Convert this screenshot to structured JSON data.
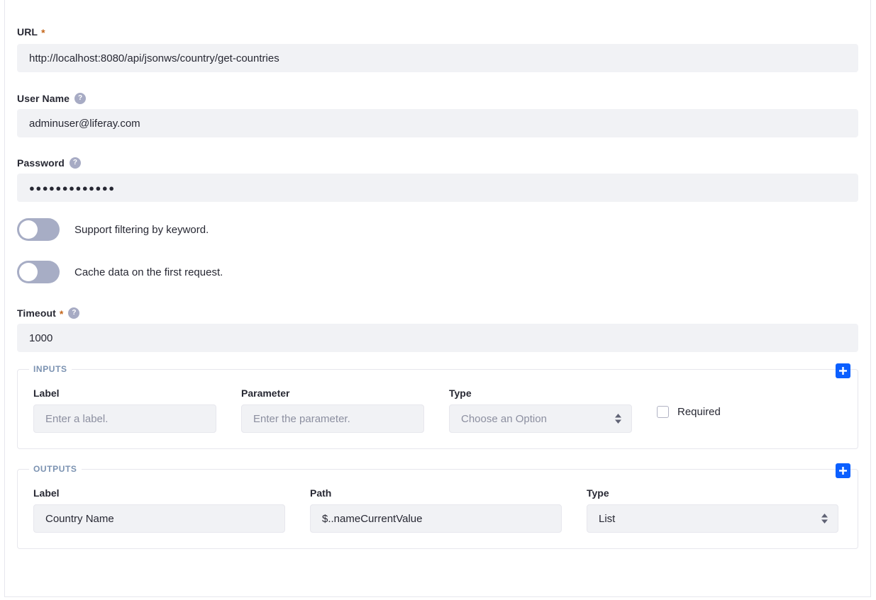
{
  "form": {
    "url": {
      "label": "URL",
      "required_marker": "*",
      "value": "http://localhost:8080/api/jsonws/country/get-countries"
    },
    "user_name": {
      "label": "User Name",
      "help_icon": "help-question-icon",
      "value": "adminuser@liferay.com"
    },
    "password": {
      "label": "Password",
      "help_icon": "help-question-icon",
      "value": "●●●●●●●●●●●●●"
    },
    "filtering_toggle": {
      "label": "Support filtering by keyword.",
      "state": "off"
    },
    "cache_toggle": {
      "label": "Cache data on the first request.",
      "state": "off"
    },
    "timeout": {
      "label": "Timeout",
      "required_marker": "*",
      "help_icon": "help-question-icon",
      "value": "1000"
    }
  },
  "inputs_group": {
    "legend": "INPUTS",
    "add_button_icon": "plus-icon",
    "row": {
      "label_field": {
        "label": "Label",
        "placeholder": "Enter a label.",
        "value": ""
      },
      "parameter_field": {
        "label": "Parameter",
        "placeholder": "Enter the parameter.",
        "value": ""
      },
      "type_field": {
        "label": "Type",
        "selected": "Choose an Option",
        "arrows_icon": "sort-order-icon"
      },
      "required_checkbox": {
        "label": "Required",
        "checked": false
      }
    }
  },
  "outputs_group": {
    "legend": "OUTPUTS",
    "add_button_icon": "plus-icon",
    "row": {
      "label_field": {
        "label": "Label",
        "value": "Country Name"
      },
      "path_field": {
        "label": "Path",
        "value": "$..nameCurrentValue"
      },
      "type_field": {
        "label": "Type",
        "selected": "List",
        "arrows_icon": "sort-order-icon"
      }
    }
  },
  "colors": {
    "accent_blue": "#0b5fff",
    "required_asterisk": "#c4661b",
    "legend_text": "#7b92b1",
    "input_background": "#f1f2f5",
    "toggle_track_off": "#a7adc5",
    "text_primary": "#272833"
  }
}
